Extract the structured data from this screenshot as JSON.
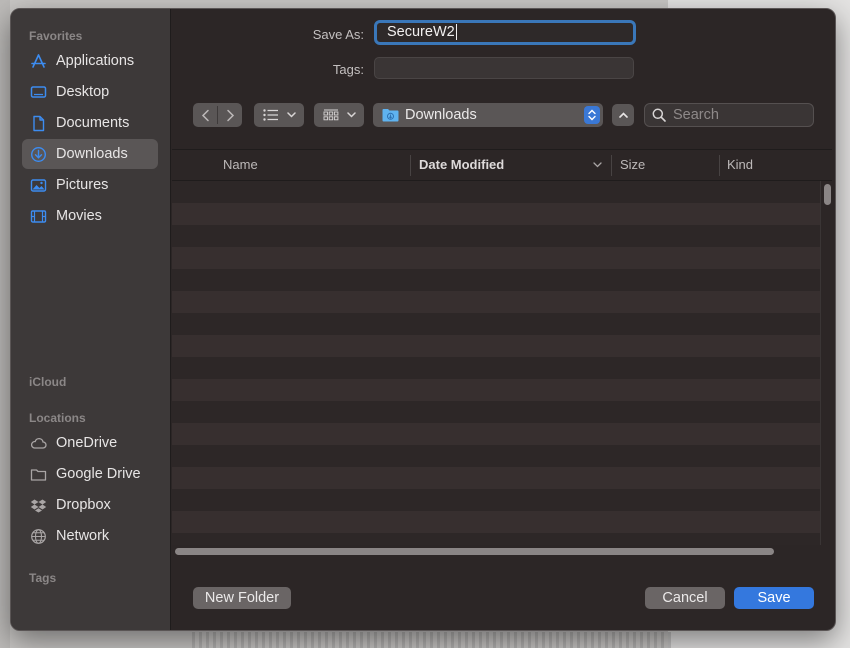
{
  "sidebar": {
    "sections": [
      {
        "title": "Favorites",
        "items": [
          {
            "label": "Applications",
            "icon": "applications-icon"
          },
          {
            "label": "Desktop",
            "icon": "desktop-icon"
          },
          {
            "label": "Documents",
            "icon": "document-icon"
          },
          {
            "label": "Downloads",
            "icon": "downloads-icon",
            "selected": true
          },
          {
            "label": "Pictures",
            "icon": "pictures-icon"
          },
          {
            "label": "Movies",
            "icon": "movies-icon"
          }
        ]
      },
      {
        "title": "iCloud",
        "items": []
      },
      {
        "title": "Locations",
        "items": [
          {
            "label": "OneDrive",
            "icon": "cloud-icon"
          },
          {
            "label": "Google Drive",
            "icon": "folder-icon"
          },
          {
            "label": "Dropbox",
            "icon": "dropbox-icon"
          },
          {
            "label": "Network",
            "icon": "globe-icon"
          }
        ]
      },
      {
        "title": "Tags",
        "items": []
      }
    ]
  },
  "form": {
    "save_as_label": "Save As:",
    "save_as_value": "SecureW2",
    "tags_label": "Tags:",
    "tags_value": ""
  },
  "toolbar": {
    "location": "Downloads",
    "search_placeholder": "Search"
  },
  "columns": [
    "Name",
    "Date Modified",
    "Size",
    "Kind"
  ],
  "footer": {
    "new_folder": "New Folder",
    "cancel": "Cancel",
    "save": "Save"
  },
  "colors": {
    "accent": "#3478de",
    "focus_ring": "#3a77b9",
    "sidebar_icon": "#3d8cf0"
  }
}
